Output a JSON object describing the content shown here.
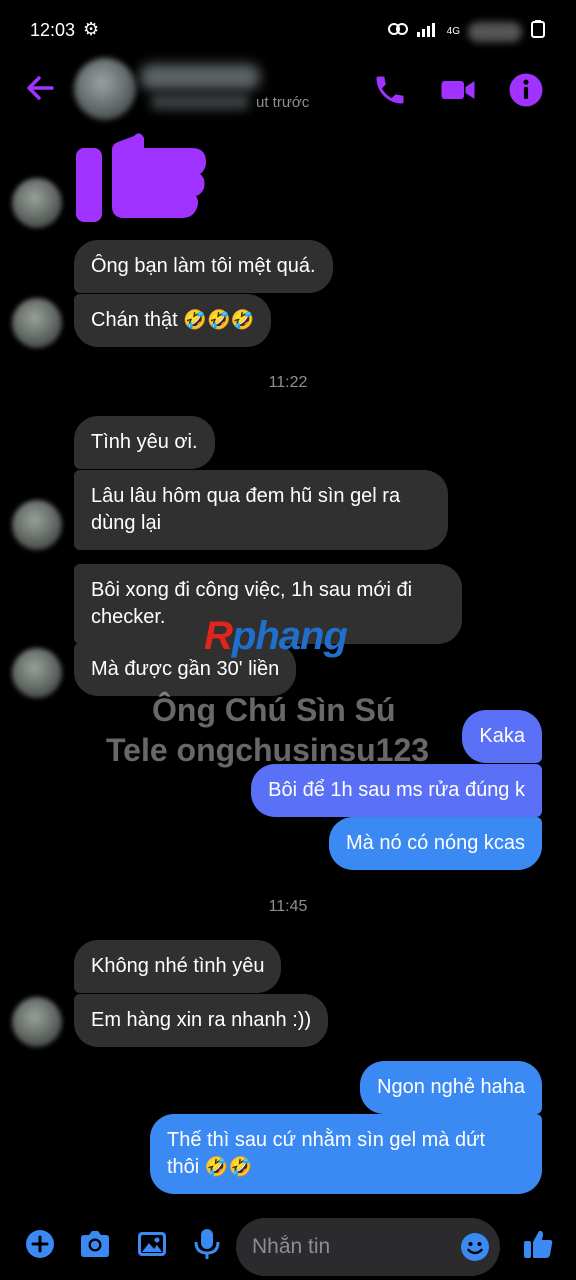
{
  "status_bar": {
    "time": "12:03",
    "network": "4G"
  },
  "header": {
    "status": "ut trước"
  },
  "messages": {
    "m1": "Ông bạn làm tôi mệt quá.",
    "m2_text": "Chán thật ",
    "m2_emoji": "🤣🤣🤣",
    "ts1": "11:22",
    "m3": "Tình yêu ơi.",
    "m4_l1": "Lâu lâu hôm qua đem hũ sìn gel ra",
    "m4_l2": "dùng lại",
    "m5_l1": "Bôi xong đi công việc, 1h sau mới đi",
    "m5_l2": "checker.",
    "m6": "Mà được gần 30' liền",
    "o1": "Kaka",
    "o2": "Bôi để 1h sau ms rửa đúng k",
    "o3": "Mà nó có nóng kcas",
    "ts2": "11:45",
    "m7": "Không nhé tình yêu",
    "m8": "Em hàng xin ra nhanh :))",
    "o4": "Ngon nghẻ haha",
    "o5_l1": "Thế thì sau cứ nhằm sìn gel mà dứt",
    "o5_l2_text": "thôi ",
    "o5_l2_emoji": "🤣🤣"
  },
  "watermark": {
    "logo_r": "R",
    "logo_rest": "phang",
    "line1": "Ông Chú Sìn Sú",
    "line2": "Tele ongchusinsu123"
  },
  "composer": {
    "placeholder": "Nhắn tin"
  },
  "colors": {
    "accent": "#a033ff",
    "incoming_bubble": "#303030",
    "outgoing_purple": "#5a70f7",
    "outgoing_blue": "#3b8af4",
    "composer_icon": "#3b8af4"
  },
  "icons": [
    "back-arrow-icon",
    "phone-icon",
    "video-icon",
    "info-icon",
    "thumbs-up-icon",
    "plus-icon",
    "camera-icon",
    "image-icon",
    "mic-icon",
    "emoji-icon",
    "like-icon"
  ]
}
